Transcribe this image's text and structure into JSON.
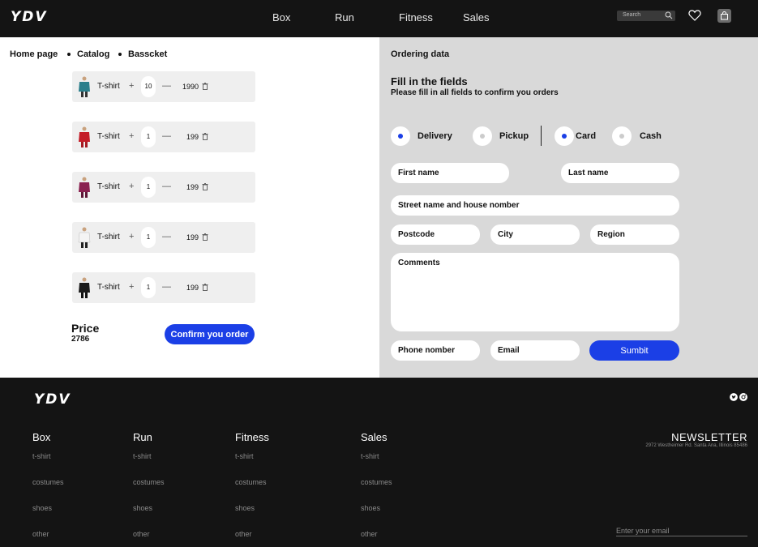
{
  "header": {
    "logo": "YDV",
    "nav": [
      "Box",
      "Run",
      "Fitness",
      "Sales"
    ],
    "search_placeholder": "Search"
  },
  "breadcrumb": [
    "Home page",
    "Catalog",
    "Basscket"
  ],
  "basket": {
    "items": [
      {
        "name": "T-shirt",
        "qty": "10",
        "price": "1990",
        "color": "#2b7f8c"
      },
      {
        "name": "T-shirt",
        "qty": "1",
        "price": "199",
        "color": "#c41d28"
      },
      {
        "name": "T-shirt",
        "qty": "1",
        "price": "199",
        "color": "#8a2150"
      },
      {
        "name": "T-shirt",
        "qty": "1",
        "price": "199",
        "color": "#e9e9e9"
      },
      {
        "name": "T-shirt",
        "qty": "1",
        "price": "199",
        "color": "#1c1c1c"
      }
    ],
    "plus": "+",
    "minus": "—",
    "price_label": "Price",
    "price_value": "2786",
    "confirm_label": "Confirm you order"
  },
  "order": {
    "title": "Ordering data",
    "heading": "Fill in the fields",
    "subheading": "Please fill in all fields to confirm you orders",
    "options": [
      {
        "label": "Delivery",
        "selected": true
      },
      {
        "label": "Pickup",
        "selected": false
      },
      {
        "label": "Card",
        "selected": true
      },
      {
        "label": "Cash",
        "selected": false
      }
    ],
    "fields": {
      "first_name": "First name",
      "last_name": "Last name",
      "street": "Street name and house nomber",
      "postcode": "Postcode",
      "city": "City",
      "region": "Region",
      "comments": "Comments",
      "phone": "Phone nomber",
      "email": "Email"
    },
    "submit_label": "Sumbit"
  },
  "footer": {
    "logo": "YDV",
    "columns": [
      {
        "title": "Box",
        "links": [
          "t-shirt",
          "costumes",
          "shoes",
          "other"
        ]
      },
      {
        "title": "Run",
        "links": [
          "t-shirt",
          "costumes",
          "shoes",
          "other"
        ]
      },
      {
        "title": "Fitness",
        "links": [
          "t-shirt",
          "costumes",
          "shoes",
          "other"
        ]
      },
      {
        "title": "Sales",
        "links": [
          "t-shirt",
          "costumes",
          "shoes",
          "other"
        ]
      }
    ],
    "newsletter_title": "NEWSLETTER",
    "address": "2972 Westheimer Rd. Santa Ana, Illinois 85486",
    "email_placeholder": "Enter your email"
  },
  "colors": {
    "accent": "#1b3fe6",
    "dark": "#141414",
    "panel": "#d9d9d9"
  }
}
